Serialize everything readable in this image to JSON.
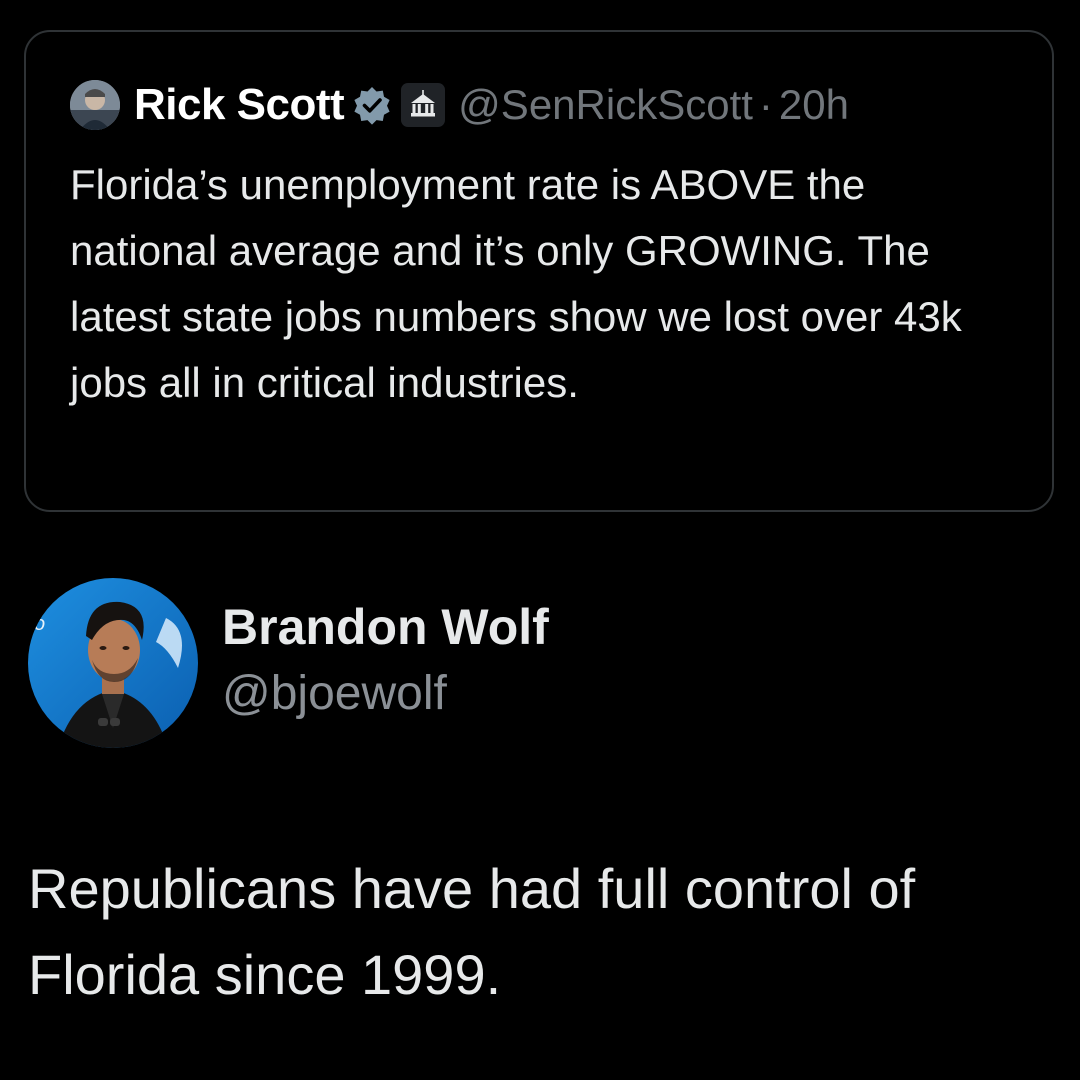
{
  "quoted_tweet": {
    "author_name": "Rick Scott",
    "handle": "@SenRickScott",
    "separator": "·",
    "time": "20h",
    "text": "Florida’s unemployment rate is ABOVE the national average and it’s only GROWING. The latest state jobs numbers show we lost over 43k jobs all in critical industries.",
    "avatar_icon": "profile-photo",
    "badges": [
      "verified-icon",
      "government-building-icon"
    ],
    "verified_color": "#829aab"
  },
  "tweet": {
    "author_name": "Brandon Wolf",
    "handle": "@bjoewolf",
    "text": "Republicans have had full control of Florida since 1999.",
    "avatar_icon": "profile-photo"
  },
  "colors": {
    "background": "#000000",
    "primary_text": "#e7e9ea",
    "secondary_text": "#71767b",
    "card_border": "#2f3336"
  }
}
